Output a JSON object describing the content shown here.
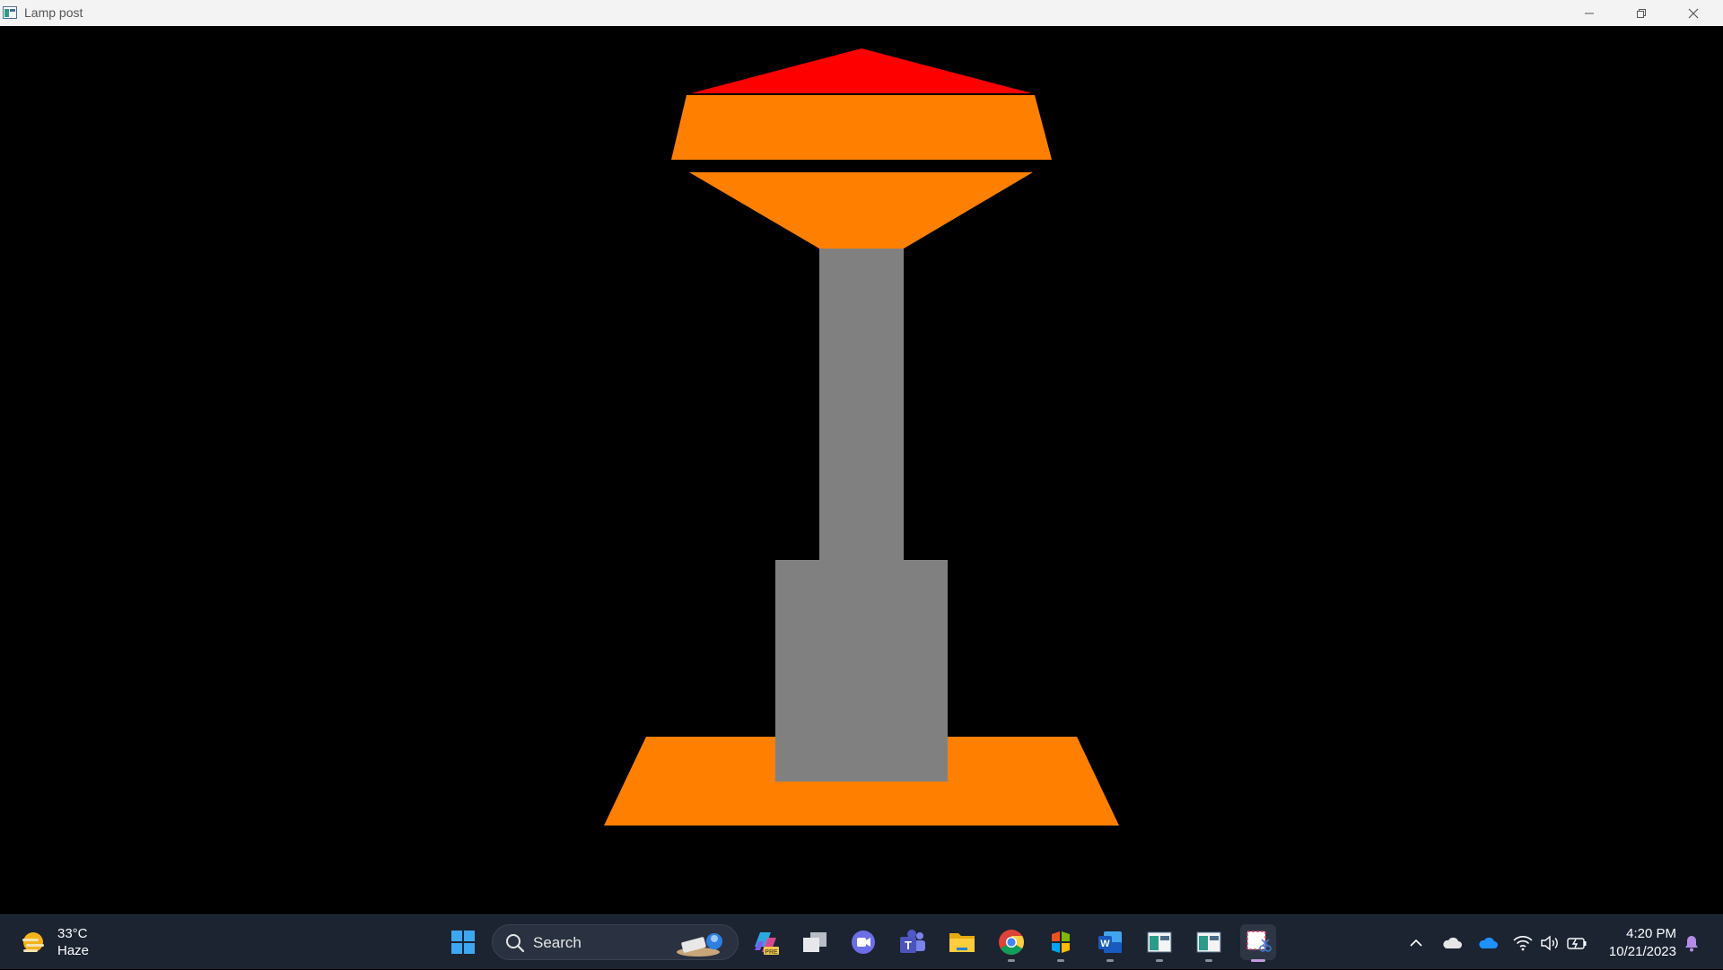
{
  "window": {
    "title": "Lamp post",
    "controls": [
      "minimize-icon",
      "restore-icon",
      "close-icon"
    ]
  },
  "scene": {
    "background": "#000000",
    "shapes": [
      {
        "name": "lamp-cap",
        "color": "#ff0000"
      },
      {
        "name": "lamp-upper-shade",
        "color": "#ff8000"
      },
      {
        "name": "lamp-lower-shade",
        "color": "#ff8000"
      },
      {
        "name": "lamp-pole",
        "color": "#808080"
      },
      {
        "name": "lamp-base-block",
        "color": "#808080"
      },
      {
        "name": "lamp-ground-plate",
        "color": "#ff8000"
      }
    ]
  },
  "taskbar": {
    "weather": {
      "temp": "33°C",
      "condition": "Haze",
      "icon": "haze-sun-icon"
    },
    "search": {
      "label": "Search"
    },
    "apps": [
      "start-icon",
      "copilot-icon",
      "task-view-icon",
      "meet-icon",
      "teams-icon",
      "file-explorer-icon",
      "chrome-icon",
      "store-icon",
      "word-icon",
      "window-app-icon",
      "window-app-icon",
      "snipping-tool-icon"
    ],
    "tray": [
      "chevron-up-icon",
      "onedrive-personal-icon",
      "onedrive-icon",
      "wifi-icon",
      "volume-icon",
      "battery-icon",
      "notification-icon"
    ],
    "clock": {
      "time": "4:20 PM",
      "date": "10/21/2023"
    }
  }
}
